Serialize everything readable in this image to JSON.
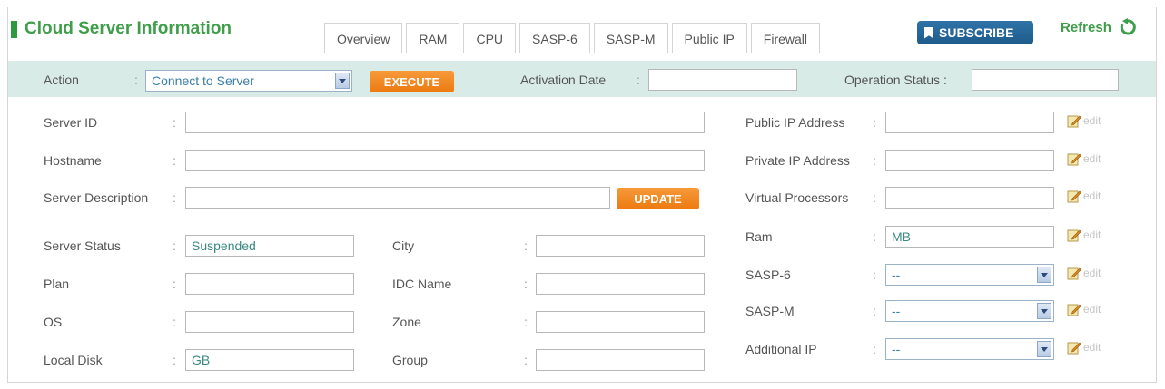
{
  "header": {
    "title": "Cloud Server Information",
    "tabs": [
      "Overview",
      "RAM",
      "CPU",
      "SASP-6",
      "SASP-M",
      "Public IP",
      "Firewall"
    ],
    "subscribe_label": "SUBSCRIBE",
    "refresh_label": "Refresh"
  },
  "actionbar": {
    "action_label": "Action",
    "action_value": "Connect to Server",
    "execute_label": "EXECUTE",
    "activation_label": "Activation Date",
    "activation_value": "",
    "operation_label": "Operation Status :",
    "operation_value": ""
  },
  "form": {
    "server_id": {
      "label": "Server ID",
      "value": ""
    },
    "hostname": {
      "label": "Hostname",
      "value": ""
    },
    "description": {
      "label": "Server Description",
      "value": ""
    },
    "update_label": "UPDATE",
    "server_status": {
      "label": "Server Status",
      "value": "Suspended"
    },
    "plan": {
      "label": "Plan",
      "value": ""
    },
    "os": {
      "label": "OS",
      "value": ""
    },
    "local_disk": {
      "label": "Local Disk",
      "value": "GB"
    },
    "city": {
      "label": "City",
      "value": ""
    },
    "idc_name": {
      "label": "IDC Name",
      "value": ""
    },
    "zone": {
      "label": "Zone",
      "value": ""
    },
    "group": {
      "label": "Group",
      "value": ""
    }
  },
  "right": {
    "public_ip": {
      "label": "Public IP Address",
      "value": ""
    },
    "private_ip": {
      "label": "Private IP Address",
      "value": ""
    },
    "vcpu": {
      "label": "Virtual Processors",
      "value": ""
    },
    "ram": {
      "label": "Ram",
      "value": "MB"
    },
    "sasp6": {
      "label": "SASP-6",
      "value": "--"
    },
    "saspm": {
      "label": "SASP-M",
      "value": "--"
    },
    "additional_ip": {
      "label": "Additional IP",
      "value": "--"
    },
    "edit_label": "edit"
  },
  "colors": {
    "brand_green": "#3f9e4a",
    "action_bar_bg": "#d8ebe7",
    "button_orange": "#ec7a10",
    "subscribe_blue": "#1e5b8a"
  },
  "icons": {
    "subscribe": "bookmark-icon",
    "refresh": "refresh-icon",
    "edit": "pencil-icon",
    "dropdown": "chevron-down-icon"
  }
}
